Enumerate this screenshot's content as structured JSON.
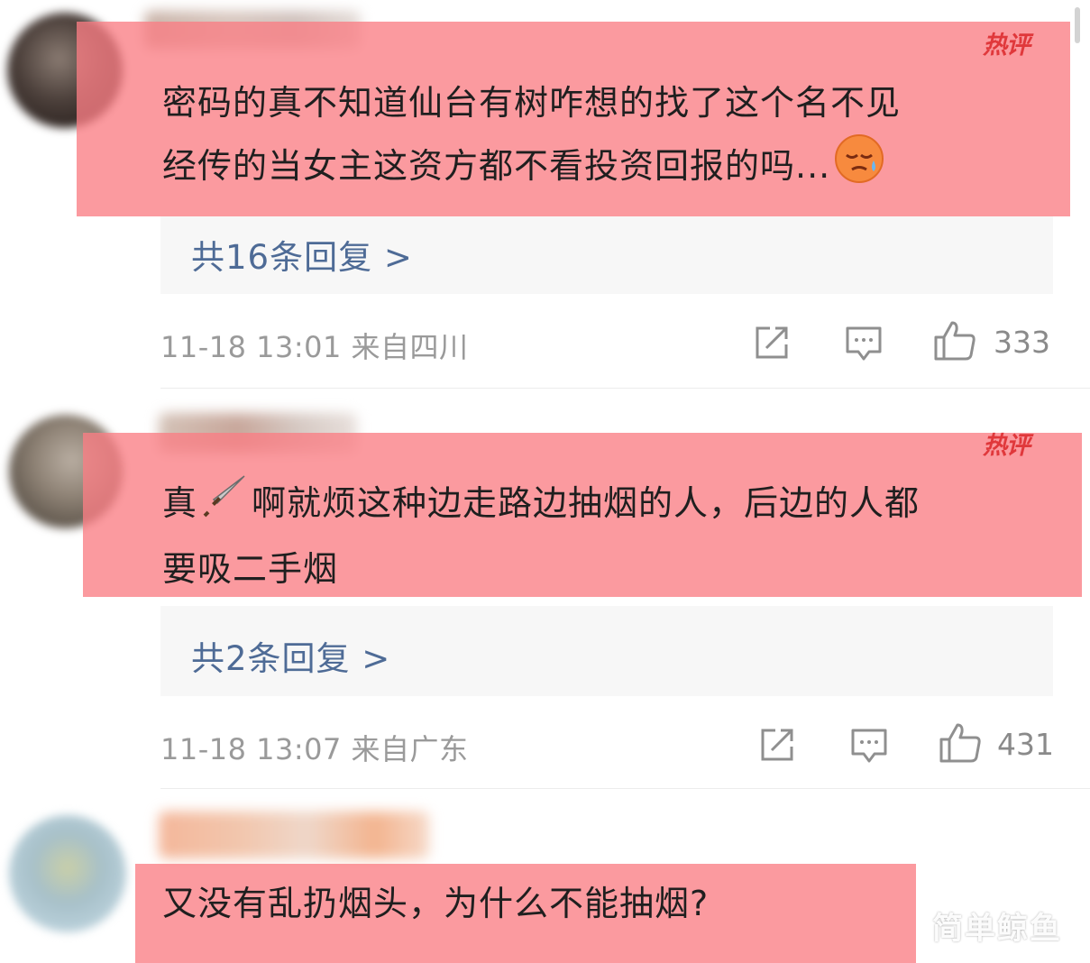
{
  "comments": [
    {
      "hot_tag": "热评",
      "text_line1": "密码的真不知道仙台有树咋想的找了这个名不见",
      "text_line2": "经传的当女主这资方都不看投资回报的吗...",
      "emoji": "sad-sweat-emoji",
      "replies_label": "共16条回复 >",
      "time_location": "11-18 13:01  来自四川",
      "like_count": "333"
    },
    {
      "hot_tag": "热评",
      "text_line1_a": "真",
      "text_line1_b": "啊就烦这种边走路边抽烟的人，后边的人都",
      "text_line2": "要吸二手烟",
      "emoji": "knife-emoji",
      "replies_label": "共2条回复 >",
      "time_location": "11-18 13:07  来自广东",
      "like_count": "431"
    },
    {
      "text_line1": "又没有乱扔烟头，为什么不能抽烟?"
    }
  ],
  "watermark": "简单鲸鱼",
  "colors": {
    "highlight": "#fa7e84",
    "hot_tag": "#e0383b",
    "reply_link": "#4e6b96",
    "meta": "#9a9a9a"
  },
  "icons": [
    "share-icon",
    "comment-icon",
    "thumbs-up-icon"
  ]
}
